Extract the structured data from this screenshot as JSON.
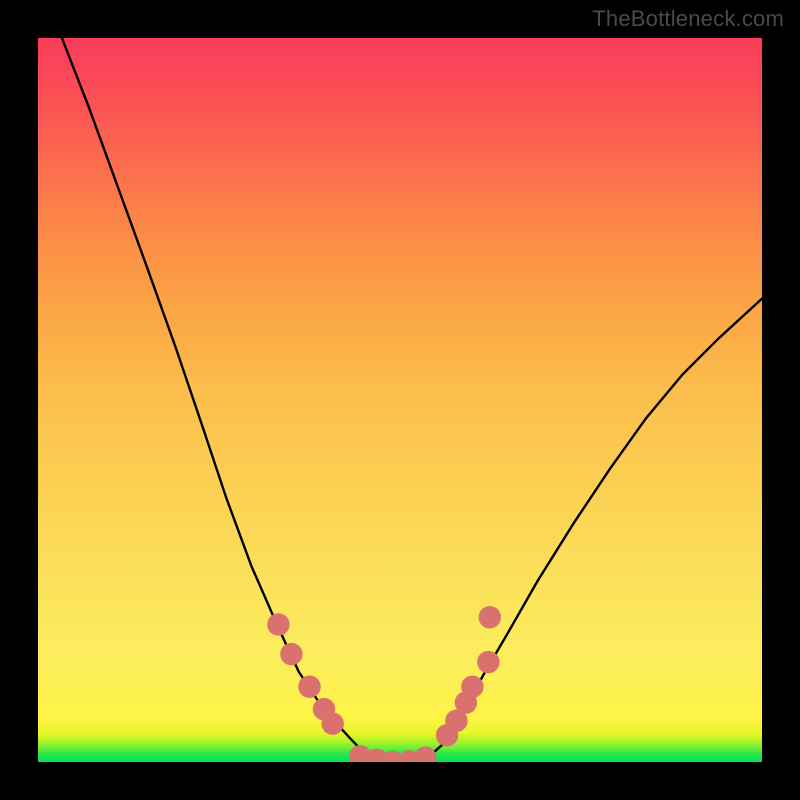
{
  "credit": "TheBottleneck.com",
  "chart_data": {
    "type": "line",
    "title": "",
    "xlabel": "",
    "ylabel": "",
    "xlim": [
      0,
      1
    ],
    "ylim": [
      0,
      1
    ],
    "curve": {
      "name": "compatibility-curve",
      "points": [
        {
          "x": 0.033,
          "y": 1.0
        },
        {
          "x": 0.07,
          "y": 0.905
        },
        {
          "x": 0.11,
          "y": 0.795
        },
        {
          "x": 0.15,
          "y": 0.685
        },
        {
          "x": 0.19,
          "y": 0.573
        },
        {
          "x": 0.225,
          "y": 0.47
        },
        {
          "x": 0.26,
          "y": 0.365
        },
        {
          "x": 0.295,
          "y": 0.27
        },
        {
          "x": 0.33,
          "y": 0.19
        },
        {
          "x": 0.36,
          "y": 0.125
        },
        {
          "x": 0.395,
          "y": 0.072
        },
        {
          "x": 0.43,
          "y": 0.034
        },
        {
          "x": 0.45,
          "y": 0.013
        },
        {
          "x": 0.465,
          "y": 0.003
        },
        {
          "x": 0.488,
          "y": 0.0
        },
        {
          "x": 0.527,
          "y": 0.003
        },
        {
          "x": 0.545,
          "y": 0.012
        },
        {
          "x": 0.562,
          "y": 0.027
        },
        {
          "x": 0.585,
          "y": 0.065
        },
        {
          "x": 0.615,
          "y": 0.12
        },
        {
          "x": 0.65,
          "y": 0.18
        },
        {
          "x": 0.69,
          "y": 0.25
        },
        {
          "x": 0.74,
          "y": 0.33
        },
        {
          "x": 0.79,
          "y": 0.405
        },
        {
          "x": 0.84,
          "y": 0.475
        },
        {
          "x": 0.89,
          "y": 0.535
        },
        {
          "x": 0.94,
          "y": 0.585
        },
        {
          "x": 1.0,
          "y": 0.64
        }
      ]
    },
    "markers": {
      "name": "highlighted-points",
      "color": "#d9716f",
      "radius_norm": 0.0155,
      "points": [
        {
          "x": 0.332,
          "y": 0.19
        },
        {
          "x": 0.35,
          "y": 0.149
        },
        {
          "x": 0.375,
          "y": 0.104
        },
        {
          "x": 0.395,
          "y": 0.073
        },
        {
          "x": 0.407,
          "y": 0.053
        },
        {
          "x": 0.445,
          "y": 0.008
        },
        {
          "x": 0.468,
          "y": 0.003
        },
        {
          "x": 0.49,
          "y": 0.0
        },
        {
          "x": 0.513,
          "y": 0.001
        },
        {
          "x": 0.535,
          "y": 0.006
        },
        {
          "x": 0.565,
          "y": 0.037
        },
        {
          "x": 0.578,
          "y": 0.057
        },
        {
          "x": 0.591,
          "y": 0.082
        },
        {
          "x": 0.6,
          "y": 0.104
        },
        {
          "x": 0.622,
          "y": 0.138
        },
        {
          "x": 0.624,
          "y": 0.2
        }
      ]
    }
  }
}
